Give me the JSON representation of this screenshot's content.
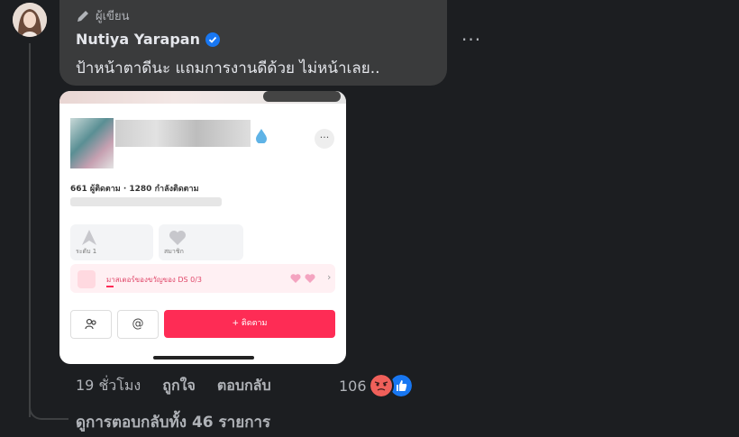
{
  "comment": {
    "badge_label": "ผู้เขียน",
    "author_name": "Nutiya Yarapan",
    "text": "ป้าหน้าตาดีนะ แถมการงานดีด้วย ไม่หน้าเลย.."
  },
  "embedded_profile": {
    "followers_text": "661 ผู้ติดตาม · 1280 กำลังติดตาม",
    "stat_left_label": "ระดับ 1",
    "stat_right_label": "สมาชิก",
    "promo_text": "มาสเตอร์ของขวัญของ DS  0/3",
    "message_button": "@",
    "follow_button": "+ ติดตาม"
  },
  "actions": {
    "time": "19 ชั่วโมง",
    "like_label": "ถูกใจ",
    "reply_label": "ตอบกลับ",
    "reaction_count": "106"
  },
  "view_replies": "ดูการตอบกลับทั้ง 46 รายการ",
  "colors": {
    "verified": "#1877f2",
    "angry": "#f0605a",
    "like": "#1877f2",
    "follow": "#fe2c55"
  }
}
